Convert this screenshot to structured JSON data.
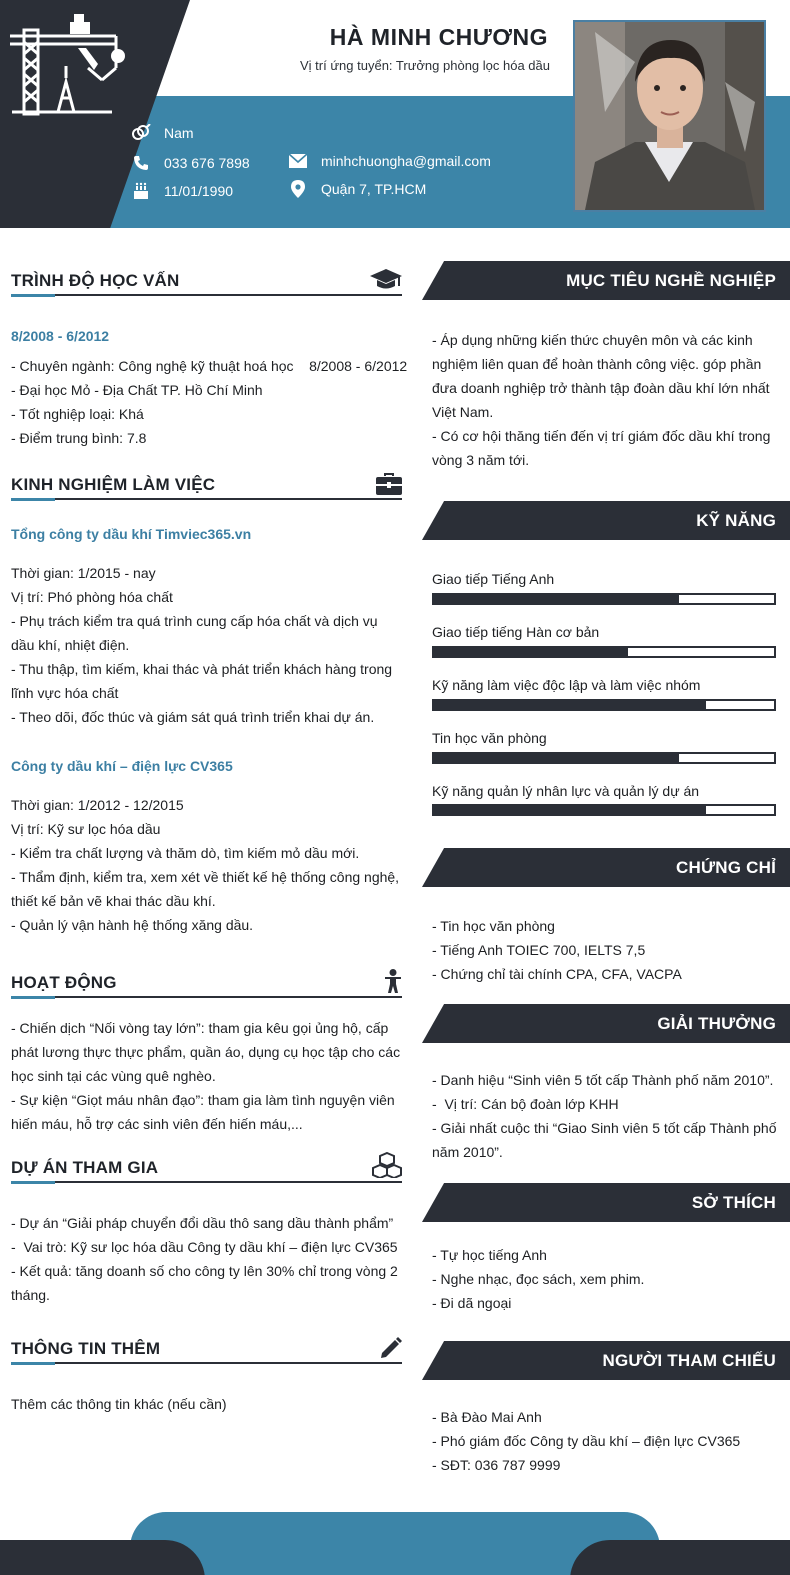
{
  "header": {
    "name": "HÀ MINH CHƯƠNG",
    "position": "Vị trí ứng tuyển: Trưởng phòng lọc hóa dầu",
    "gender": "Nam",
    "phone": "033 676 7898",
    "birthday": "11/01/1990",
    "email": "minhchuongha@gmail.com",
    "address": "Quận 7, TP.HCM"
  },
  "education": {
    "title": "TRÌNH ĐỘ HỌC VẤN",
    "period": "8/2008 - 6/2012",
    "lines": [
      "- Chuyên ngành: Công nghệ kỹ thuật hoá học    8/2008 - 6/2012",
      "- Đại học Mỏ - Địa Chất TP. Hồ Chí Minh",
      "- Tốt nghiệp loại: Khá",
      "- Điểm trung bình: 7.8"
    ]
  },
  "experience": {
    "title": "KINH NGHIỆM LÀM VIỆC",
    "jobs": [
      {
        "company": "Tổng công ty dầu khí Timviec365.vn",
        "lines": [
          "Thời gian: 1/2015 - nay",
          "Vị trí: Phó phòng hóa chất",
          "- Phụ trách kiểm tra quá trình cung cấp hóa chất và dịch vụ dầu khí, nhiệt điện.",
          "- Thu thập, tìm kiếm, khai thác và phát triển khách hàng trong lĩnh vực hóa chất",
          "- Theo dõi, đốc thúc và giám sát quá trình triển khai dự án."
        ]
      },
      {
        "company": "Công ty dầu khí – điện lực CV365",
        "lines": [
          "Thời gian: 1/2012 - 12/2015",
          "Vị trí: Kỹ sư lọc hóa dầu",
          "- Kiểm tra chất lượng và thăm dò, tìm kiếm mỏ dầu mới.",
          "- Thẩm định, kiểm tra, xem xét về thiết kế hệ thống công nghệ, thiết kế bản vẽ khai thác dầu khí.",
          "- Quản lý vận hành hệ thống xăng dầu."
        ]
      }
    ]
  },
  "activities": {
    "title": "HOẠT ĐỘNG",
    "lines": [
      "- Chiến dịch “Nối vòng tay lớn”: tham gia kêu gọi ủng hộ, cấp phát lương thực thực phẩm, quần áo, dụng cụ học tập cho các học sinh tại các vùng quê nghèo.",
      "- Sự kiện “Giọt máu nhân đạo”: tham gia làm tình nguyện viên hiến máu, hỗ trợ các sinh viên đến hiến máu,..."
    ]
  },
  "projects": {
    "title": "DỰ ÁN THAM GIA",
    "lines": [
      "- Dự án “Giải pháp chuyển đổi dầu thô sang dầu thành phẩm”",
      "-  Vai trò: Kỹ sư lọc hóa dầu Công ty dầu khí – điện lực CV365",
      "- Kết quả: tăng doanh số cho công ty lên 30% chỉ trong vòng 2 tháng."
    ]
  },
  "more_info": {
    "title": "THÔNG TIN THÊM",
    "text": "Thêm các thông tin khác (nếu cần)"
  },
  "objective": {
    "title": "MỤC TIÊU NGHỀ NGHIỆP",
    "lines": [
      " - Áp dụng những kiến thức chuyên môn và các kinh nghiệm liên quan để hoàn thành công việc. góp phần đưa doanh nghiệp trở thành tập đoàn dầu khí lớn nhất Việt Nam.",
      " - Có cơ hội thăng tiến đến vị trí giám đốc dầu khí trong vòng 3 năm tới."
    ]
  },
  "skills": {
    "title": "KỸ NĂNG",
    "items": [
      {
        "label": "Giao tiếp Tiếng Anh",
        "level": 0.72
      },
      {
        "label": "Giao tiếp tiếng Hàn cơ bản",
        "level": 0.57
      },
      {
        "label": "Kỹ năng làm việc độc lập và làm việc nhóm",
        "level": 0.8
      },
      {
        "label": "Tin học văn phòng",
        "level": 0.72
      },
      {
        "label": "Kỹ năng quản lý nhân lực và quản lý dự án",
        "level": 0.8
      }
    ]
  },
  "certificates": {
    "title": "CHỨNG CHỈ",
    "lines": [
      "- Tin học văn phòng",
      "- Tiếng Anh TOIEC 700, IELTS 7,5",
      "- Chứng chỉ tài chính CPA, CFA, VACPA"
    ]
  },
  "awards": {
    "title": "GIẢI THƯỞNG",
    "lines": [
      "- Danh hiệu “Sinh viên 5 tốt cấp Thành phố năm 2010”.",
      "-  Vị trí: Cán bộ đoàn lớp KHH",
      "- Giải nhất cuộc thi “Giao Sinh viên 5 tốt cấp Thành phố năm 2010”."
    ]
  },
  "hobbies": {
    "title": "SỞ THÍCH",
    "lines": [
      "- Tự học tiếng Anh",
      "- Nghe nhạc, đọc sách, xem phim.",
      "- Đi dã ngoại"
    ]
  },
  "references": {
    "title": "NGƯỜI THAM CHIẾU",
    "lines": [
      "- Bà Đào Mai Anh",
      "- Phó giám đốc Công ty dầu khí – điện lực CV365",
      "- SĐT: 036 787 9999"
    ]
  },
  "colors": {
    "dark": "#2b2f37",
    "accent_blue": "#3c85a8",
    "company_blue": "#3c7fa3"
  }
}
